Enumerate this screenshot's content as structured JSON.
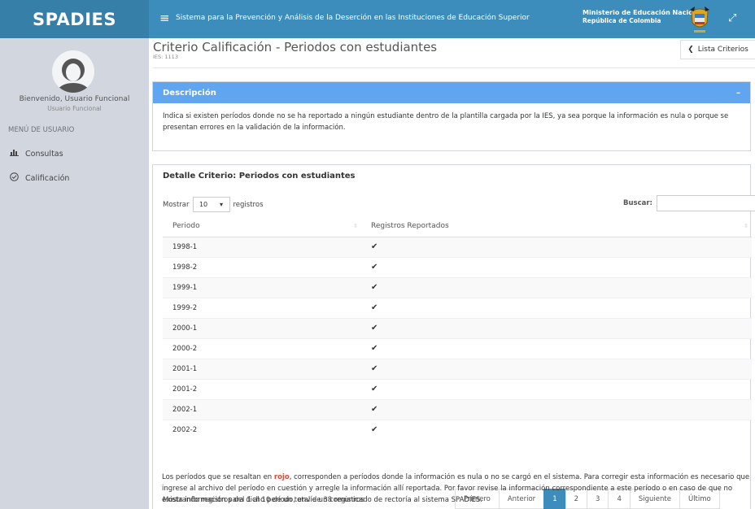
{
  "header": {
    "logo": "SPADIES",
    "menu_icon": "hamburger-icon",
    "system_title": "Sistema para la Prevención y Análisis de la Deserción en las Instituciones de Educación Superior",
    "ministry_line1": "Ministerio de Educación Nacional",
    "ministry_line2": "República de Colombia",
    "expand_icon": "expand-icon",
    "colors": {
      "header": "#3c8dbc",
      "logo_bg": "#367fa9"
    }
  },
  "sidebar": {
    "user_name": "Bienvenido, Usuario Funcional",
    "user_role": "Usuario Funcional",
    "menu_header": "MENÚ DE USUARIO",
    "items": [
      {
        "label": "Consultas",
        "icon": "bar-chart-icon"
      },
      {
        "label": "Calificación",
        "icon": "check-circle-icon"
      }
    ]
  },
  "page": {
    "title": "Criterio Calificación - Periodos con estudiantes",
    "subtitle": "IES: 1113",
    "back_button": "Lista Criterios"
  },
  "description": {
    "title": "Descripción",
    "collapse": "–",
    "text": "Indica si existen períodos donde no se ha reportado a ningún estudiante dentro de la plantilla cargada por la IES, ya sea porque la información es nula o porque se presentan errores en la validación de la información."
  },
  "detail": {
    "title": "Detalle Criterio: Periodos con estudiantes",
    "show_label": "Mostrar",
    "show_value": "10",
    "records_label": "registros",
    "search_label": "Buscar:",
    "columns": [
      "Periodo",
      "Registros Reportados"
    ],
    "rows": [
      {
        "periodo": "1998-1",
        "reportado": "✔"
      },
      {
        "periodo": "1998-2",
        "reportado": "✔"
      },
      {
        "periodo": "1999-1",
        "reportado": "✔"
      },
      {
        "periodo": "1999-2",
        "reportado": "✔"
      },
      {
        "periodo": "2000-1",
        "reportado": "✔"
      },
      {
        "periodo": "2000-2",
        "reportado": "✔"
      },
      {
        "periodo": "2001-1",
        "reportado": "✔"
      },
      {
        "periodo": "2001-2",
        "reportado": "✔"
      },
      {
        "periodo": "2002-1",
        "reportado": "✔"
      },
      {
        "periodo": "2002-2",
        "reportado": "✔"
      }
    ],
    "info": "Mostrando registros del 1 al 10 de un total de 38 registros",
    "pagination": [
      "Primero",
      "Anterior",
      "1",
      "2",
      "3",
      "4",
      "Siguiente",
      "Último"
    ],
    "active_page": "1"
  },
  "footer_note": {
    "before": "Los períodos que se resaltan en ",
    "highlight": "rojo",
    "after": ", corresponden a períodos donde la información es nula o no se cargó en el sistema. Para corregir esta información es necesario que ingrese al archivo del período en cuestión y arregle la información allí reportada. Por favor revise la información correspondiente a este período o en caso de que no exista información para dicho período, envíe un comunicado de rectoría al sistema SPADIES."
  }
}
